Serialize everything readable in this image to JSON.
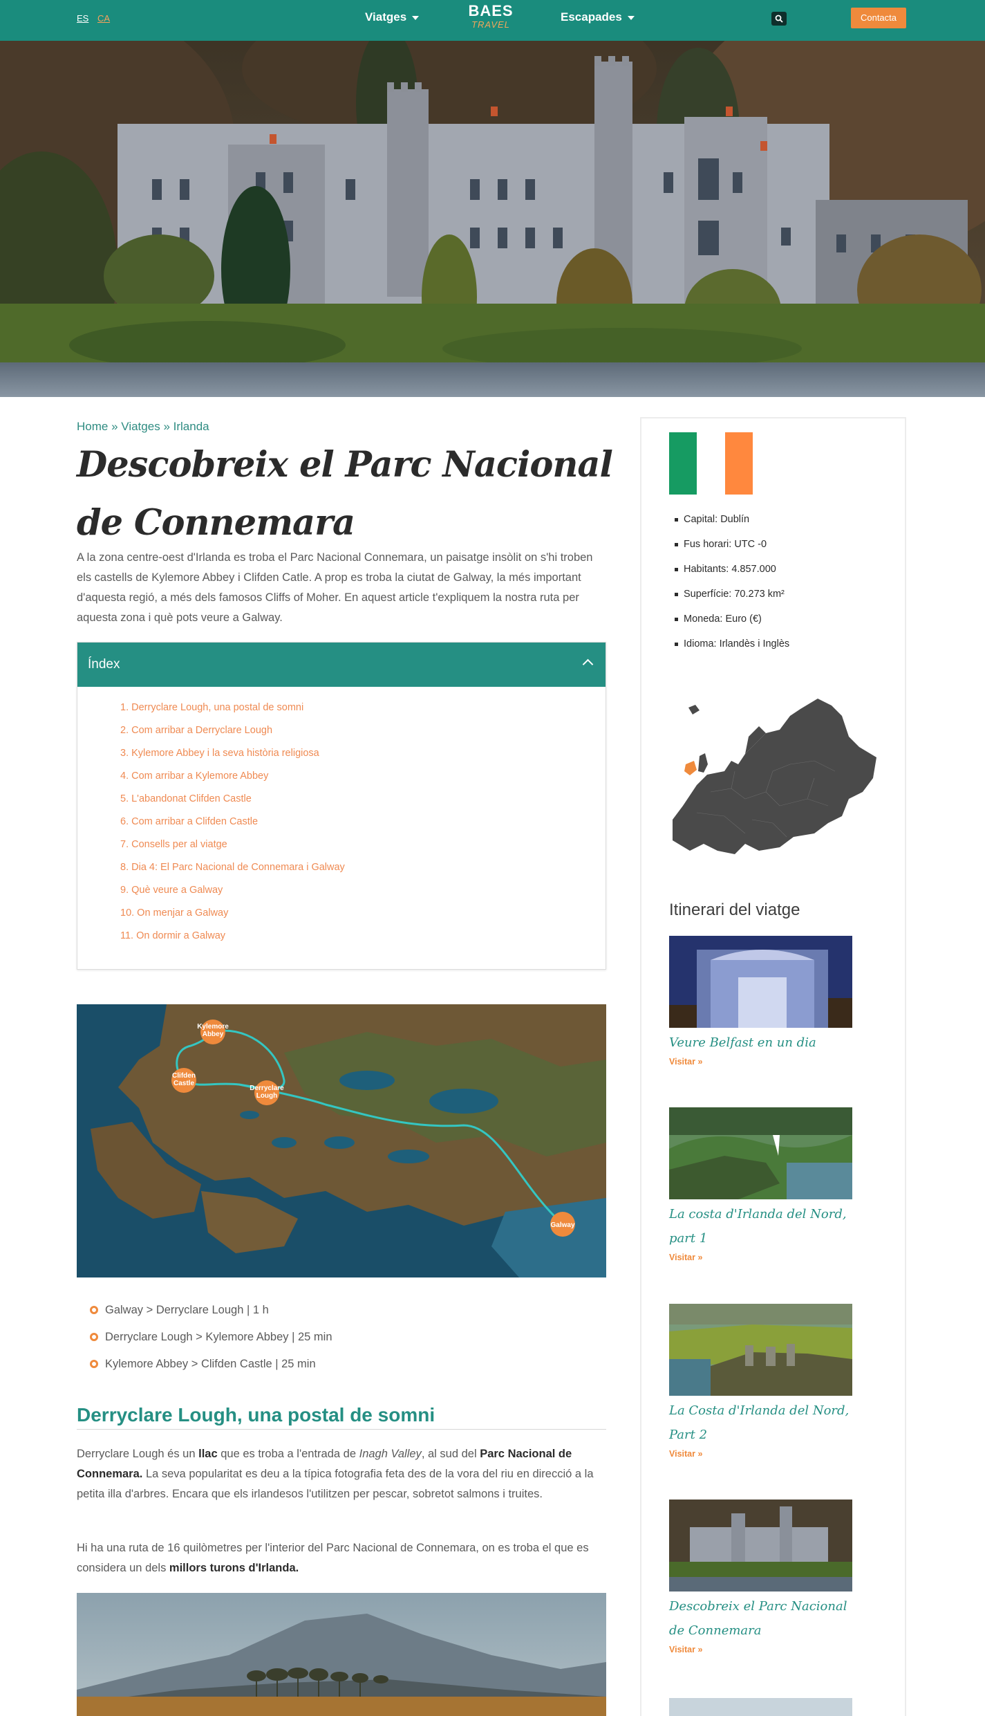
{
  "nav": {
    "lang_es": "ES",
    "lang_ca": "CA",
    "viatges": "Viatges",
    "escapades": "Escapades",
    "logo_main": "BAES",
    "logo_sub": "TRAVEL",
    "contact": "Contacta"
  },
  "breadcrumb": {
    "home": "Home",
    "viatges": "Viatges",
    "irlanda": "Irlanda",
    "separator": "»"
  },
  "title": "Descobreix el Parc Nacional de Connemara",
  "intro": "A la zona centre-oest d'Irlanda es troba el Parc Nacional Connemara, un paisatge insòlit on s'hi troben els castells de Kylemore Abbey i Clifden Catle. A prop es troba la ciutat de Galway, la més important d'aquesta regió, a més dels famosos Cliffs of Moher. En aquest article t'expliquem la nostra ruta per aquesta zona i què pots veure a Galway.",
  "toc": {
    "heading": "Índex",
    "items": [
      "1.  Derryclare Lough, una postal de somni",
      "2.  Com arribar a Derryclare Lough",
      "3.  Kylemore Abbey i la seva història religiosa",
      "4.  Com arribar a Kylemore Abbey",
      "5.  L'abandonat Clifden Castle",
      "6.  Com arribar a Clifden Castle",
      "7.  Consells per al viatge",
      "8.  Dia 4: El Parc Nacional de Connemara i Galway",
      "9.  Què veure a Galway",
      "10.  On menjar a Galway",
      "11.  On dormir a Galway"
    ]
  },
  "map": {
    "labels": [
      "Kylemore Abbey",
      "Clifden Castle",
      "Derryclare Lough",
      "Galway"
    ],
    "label_lines": [
      [
        "Kylemore",
        "Abbey"
      ],
      [
        "Clifden",
        "Castle"
      ],
      [
        "Derryclare",
        "Lough"
      ],
      [
        "Galway"
      ]
    ]
  },
  "route": [
    "Galway > Derryclare Lough | 1 h",
    "Derryclare Lough > Kylemore Abbey | 25 min",
    "Kylemore Abbey > Clifden Castle | 25 min"
  ],
  "section": {
    "title": "Derryclare Lough, una postal de somni",
    "p1_a": "Derryclare Lough és un ",
    "p1_b": "llac",
    "p1_c": " que es troba a l'entrada de ",
    "p1_d": "Inagh Valley",
    "p1_e": ", al sud del ",
    "p1_f": "Parc Nacional de Connemara.",
    "p1_g": " La seva popularitat es deu a la típica fotografia feta des de la vora del riu en direcció a la petita illa d'arbres. Encara que els irlandesos l'utilitzen per pescar, sobretot salmons i truites.",
    "p2_a": "Hi ha una ruta de 16 quilòmetres per l'interior del Parc Nacional de Connemara, on es troba el que es considera un dels ",
    "p2_b": "millors turons d'Irlanda."
  },
  "sidebar": {
    "facts": [
      "Capital: Dublín",
      "Fus horari: UTC -0",
      "Habitants: 4.857.000",
      "Superfície: 70.273 km²",
      "Moneda: Euro (€)",
      "Idioma: Irlandès i Inglès"
    ],
    "flag_colors": [
      "#169b62",
      "#ffffff",
      "#ff883e"
    ],
    "itinerary_title": "Itinerari del viatge",
    "cards": [
      {
        "title": "Veure Belfast en un dia",
        "visit": "Visitar »"
      },
      {
        "title": "La costa d'Irlanda del Nord, part 1",
        "visit": "Visitar »"
      },
      {
        "title": "La Costa d'Irlanda del Nord, Part 2",
        "visit": "Visitar »"
      },
      {
        "title": "Descobreix el Parc Nacional de Connemara",
        "visit": "Visitar »"
      }
    ]
  },
  "colors": {
    "brand_teal": "#1a8c7d",
    "accent_orange": "#ef8a3c",
    "toc_teal": "#258f83"
  }
}
